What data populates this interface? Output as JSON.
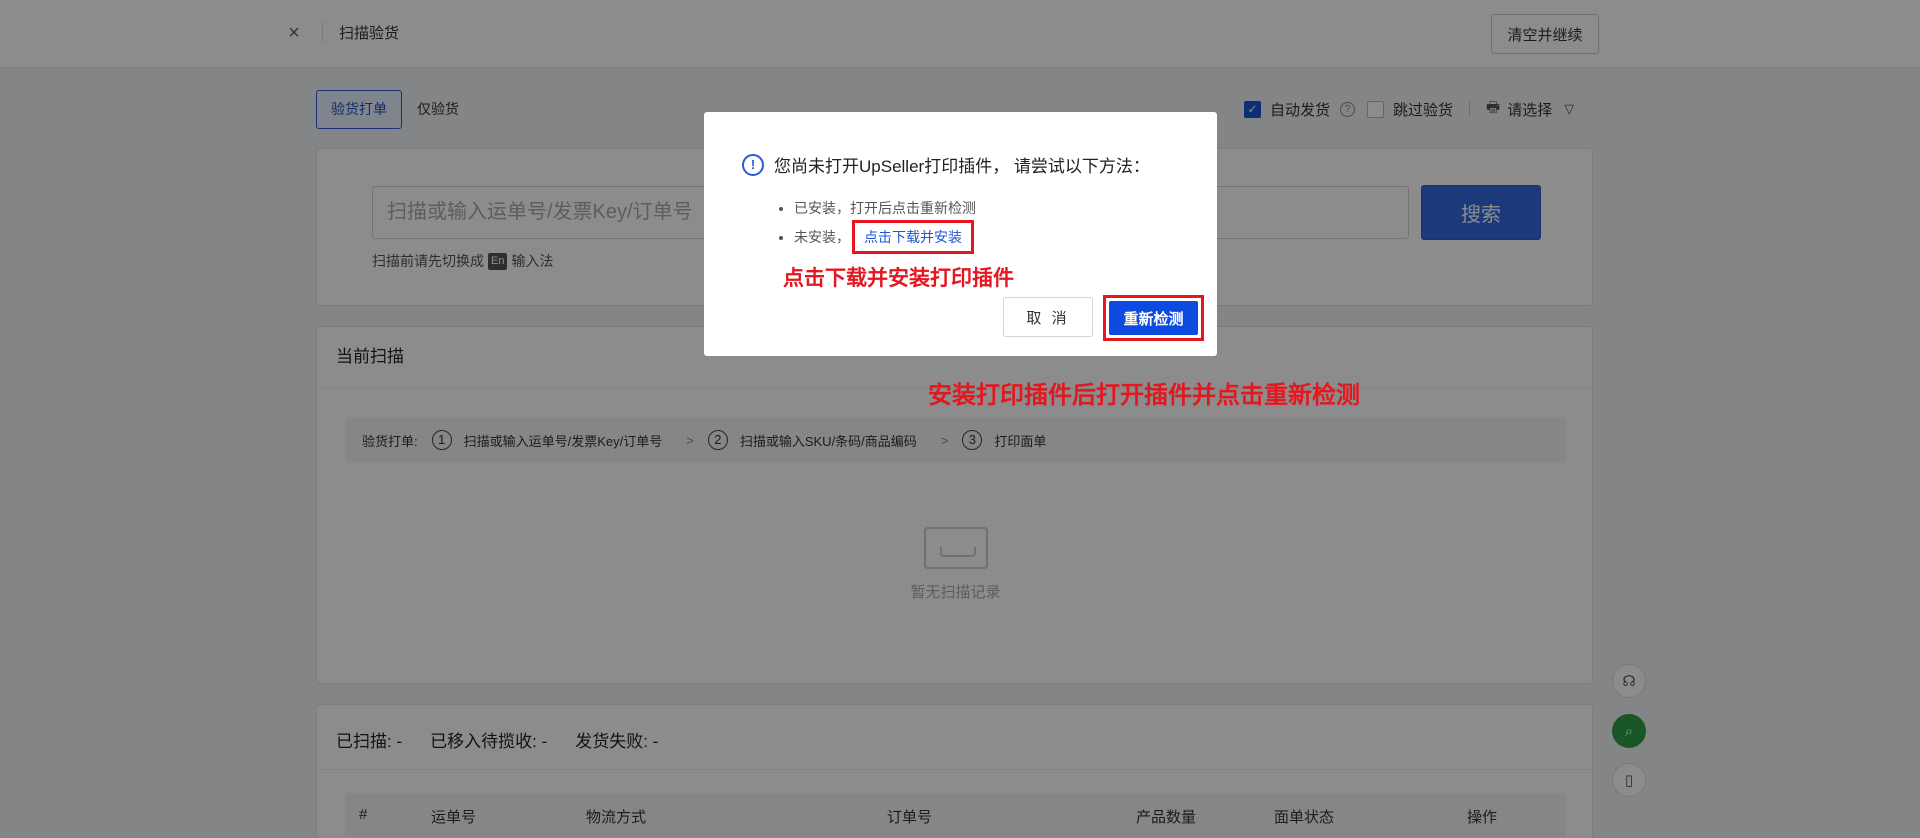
{
  "topbar": {
    "close_icon": "×",
    "title": "扫描验货",
    "clear_button": "清空并继续"
  },
  "mode_tabs": [
    {
      "label": "验货打单",
      "active": true
    },
    {
      "label": "仅验货",
      "active": false
    }
  ],
  "options": {
    "auto_ship_label": "自动发货",
    "auto_ship_checked": true,
    "help_icon": "?",
    "skip_inspection_label": "跳过验货",
    "skip_inspection_checked": false,
    "printer_select": "请选择"
  },
  "search": {
    "placeholder": "扫描或输入运单号/发票Key/订单号",
    "button": "搜索",
    "hint_before": "扫描前请先切换成",
    "hint_badge": "En",
    "hint_after": "输入法"
  },
  "current_scan": {
    "title": "当前扫描",
    "steps_label": "验货打单:",
    "steps": [
      {
        "num": "1",
        "label": "扫描或输入运单号/发票Key/订单号"
      },
      {
        "num": "2",
        "label": "扫描或输入SKU/条码/商品编码"
      },
      {
        "num": "3",
        "label": "打印面单"
      }
    ],
    "empty_text": "暂无扫描记录"
  },
  "results": {
    "scanned": "已扫描: -",
    "moved": "已移入待揽收: -",
    "failed": "发货失败: -",
    "columns": [
      "#",
      "运单号",
      "物流方式",
      "订单号",
      "产品数量",
      "面单状态",
      "操作"
    ]
  },
  "dialog": {
    "info_icon": "!",
    "title": "您尚未打开UpSeller打印插件， 请尝试以下方法：",
    "item1": "已安装，打开后点击重新检测",
    "item2_prefix": "未安装，",
    "item2_link": "点击下载并安装",
    "annotation1": "点击下载并安装打印插件",
    "cancel_button": "取 消",
    "recheck_button": "重新检测"
  },
  "annotation2": "安装打印插件后打开插件并点击重新检测",
  "colors": {
    "primary": "#1a56db",
    "annotation_red": "#e4161f",
    "float_green": "#2e9f49"
  }
}
